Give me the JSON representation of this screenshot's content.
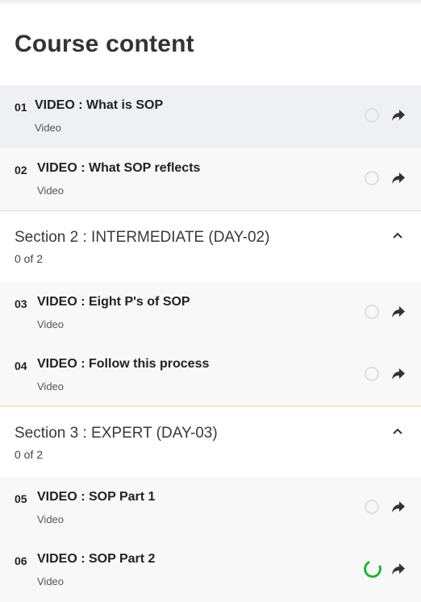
{
  "page": {
    "title": "Course content"
  },
  "lessons_a": [
    {
      "num": "01",
      "title": "VIDEO : What is SOP",
      "type": "Video",
      "status": "not-started"
    },
    {
      "num": "02",
      "title": "VIDEO : What SOP reflects",
      "type": "Video",
      "status": "not-started"
    }
  ],
  "section2": {
    "title": "Section 2 : INTERMEDIATE (DAY-02)",
    "count": "0 of 2",
    "lessons": [
      {
        "num": "03",
        "title": "VIDEO : Eight P's of SOP",
        "type": "Video",
        "status": "not-started"
      },
      {
        "num": "04",
        "title": "VIDEO : Follow this process",
        "type": "Video",
        "status": "not-started"
      }
    ]
  },
  "section3": {
    "title": "Section 3 : EXPERT (DAY-03)",
    "count": "0 of 2",
    "lessons": [
      {
        "num": "05",
        "title": "VIDEO : SOP Part 1",
        "type": "Video",
        "status": "not-started"
      },
      {
        "num": "06",
        "title": "VIDEO : SOP Part 2",
        "type": "Video",
        "status": "in-progress"
      }
    ]
  },
  "icons": {
    "status": "status-circle-icon",
    "share": "share-arrow-icon",
    "collapse": "chevron-up-icon"
  },
  "colors": {
    "active_row": "#eff0f4",
    "row": "#f8f8f9",
    "progress": "#27b03a",
    "icon": "#333333"
  }
}
